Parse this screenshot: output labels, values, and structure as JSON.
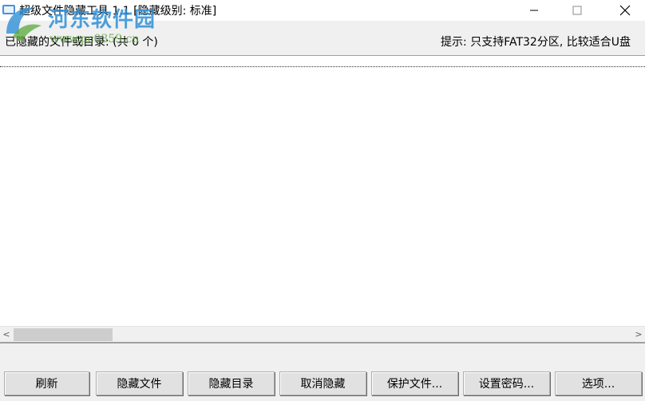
{
  "window": {
    "title": "超级文件隐藏工具 1.1  [隐藏级别: 标准]",
    "icons": {
      "app": "app-icon",
      "minimize": "minimize-icon",
      "maximize": "maximize-icon",
      "close": "close-icon"
    }
  },
  "watermark": {
    "text": "河东软件园",
    "url": "www.pc0359.cn",
    "colors": {
      "text": "#2f8fd6",
      "url": "#5aa93a"
    }
  },
  "header": {
    "hidden_label": "已隐藏的文件或目录: (共 0 个)",
    "hint": "提示: 只支持FAT32分区, 比较适合U盘"
  },
  "scrollbar": {
    "left_arrow": "<",
    "right_arrow": ">"
  },
  "buttons": {
    "refresh": "刷新",
    "hide_file": "隐藏文件",
    "hide_dir": "隐藏目录",
    "unhide": "取消隐藏",
    "protect_file": "保护文件...",
    "set_password": "设置密码...",
    "options": "选项..."
  }
}
